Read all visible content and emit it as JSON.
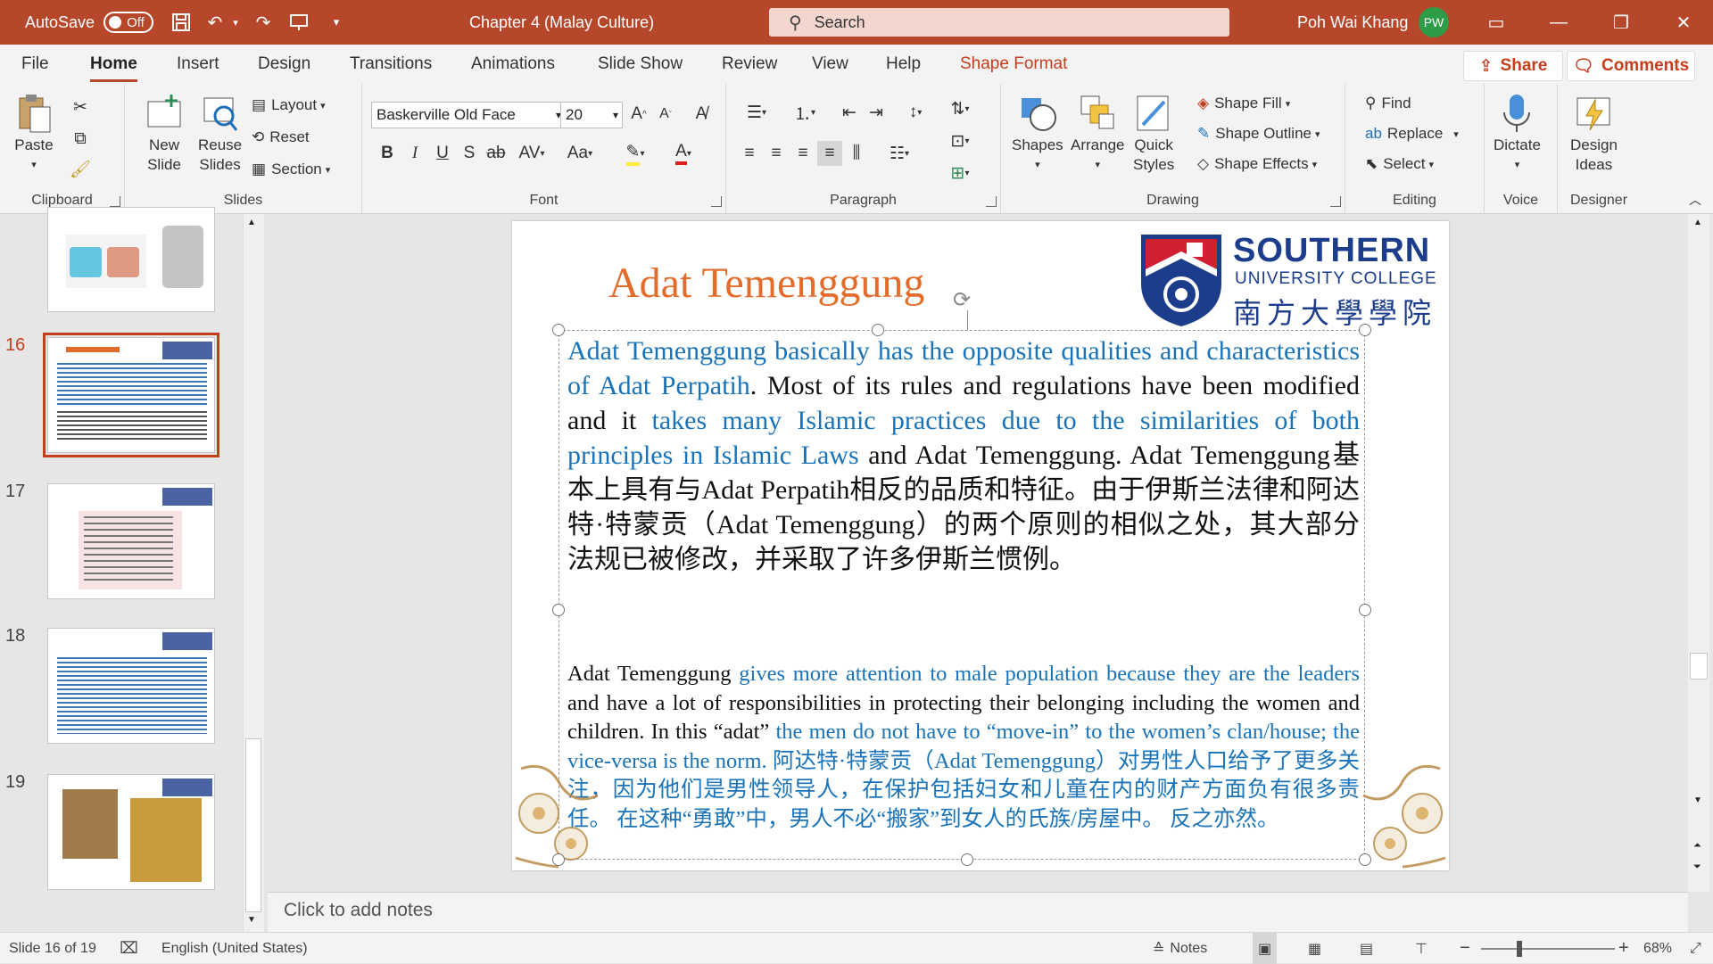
{
  "titlebar": {
    "autosave_label": "AutoSave",
    "autosave_state": "Off",
    "doc_title": "Chapter 4 (Malay Culture)",
    "search_placeholder": "Search",
    "user_name": "Poh Wai Khang",
    "user_initials": "PW"
  },
  "tabs": [
    "File",
    "Home",
    "Insert",
    "Design",
    "Transitions",
    "Animations",
    "Slide Show",
    "Review",
    "View",
    "Help",
    "Shape Format"
  ],
  "share_label": "Share",
  "comments_label": "Comments",
  "ribbon": {
    "clipboard": {
      "label": "Clipboard",
      "paste": "Paste"
    },
    "slides": {
      "label": "Slides",
      "new_slide": "New\nSlide",
      "reuse_slides": "Reuse\nSlides",
      "layout": "Layout",
      "reset": "Reset",
      "section": "Section"
    },
    "font": {
      "label": "Font",
      "family": "Baskerville Old Face",
      "size": "20"
    },
    "paragraph": {
      "label": "Paragraph"
    },
    "drawing": {
      "label": "Drawing",
      "shapes": "Shapes",
      "arrange": "Arrange",
      "quick_styles": "Quick\nStyles",
      "shape_fill": "Shape Fill",
      "shape_outline": "Shape Outline",
      "shape_effects": "Shape Effects"
    },
    "editing": {
      "label": "Editing",
      "find": "Find",
      "replace": "Replace",
      "select": "Select"
    },
    "voice": {
      "label": "Voice",
      "dictate": "Dictate"
    },
    "designer": {
      "label": "Designer",
      "design_ideas": "Design\nIdeas"
    }
  },
  "thumbnails": [
    {
      "num": ""
    },
    {
      "num": "16"
    },
    {
      "num": "17"
    },
    {
      "num": "18"
    },
    {
      "num": "19"
    }
  ],
  "slide": {
    "title": "Adat Temenggung",
    "logo": {
      "line1": "SOUTHERN",
      "line2": "UNIVERSITY COLLEGE",
      "line3": "南方大學學院"
    },
    "p1": [
      {
        "t": "Adat Temenggung basically has the opposite qualities and characteristics of Adat Perpatih",
        "c": "blue"
      },
      {
        "t": ". Most of its rules and regulations have been modified and it ",
        "c": ""
      },
      {
        "t": "takes many Islamic practices due to the similarities of both principles in Islamic Laws",
        "c": "blue"
      },
      {
        "t": " and Adat Temenggung. Adat Temenggung基本上具有与Adat Perpatih相反的品质和特征。由于伊斯兰法律和阿达特·特蒙贡（Adat Temenggung）的两个原则的相似之处，其大部分法规已被修改，并采取了许多伊斯兰惯例。",
        "c": ""
      }
    ],
    "p2": [
      {
        "t": "Adat Temenggung ",
        "c": ""
      },
      {
        "t": "gives more attention to male population because they are the leaders",
        "c": "blue"
      },
      {
        "t": " and have a lot of responsibilities in protecting their belonging including the women and children. In this “adat” ",
        "c": ""
      },
      {
        "t": "the men do not have to “move-in” to the women’s clan/house; the vice-versa is the norm. 阿达特·特蒙贡（Adat Temenggung）对男性人口给予了更多关注，因为他们是男性领导人，在保护包括妇女和儿童在内的财产方面负有很多责任。 在这种“勇敢”中，男人不必“搬家”到女人的氏族/房屋中。 反之亦然。",
        "c": "blue"
      }
    ]
  },
  "notes_placeholder": "Click to add notes",
  "status": {
    "slide_info": "Slide 16 of 19",
    "language": "English (United States)",
    "notes": "Notes",
    "zoom": "68%"
  }
}
